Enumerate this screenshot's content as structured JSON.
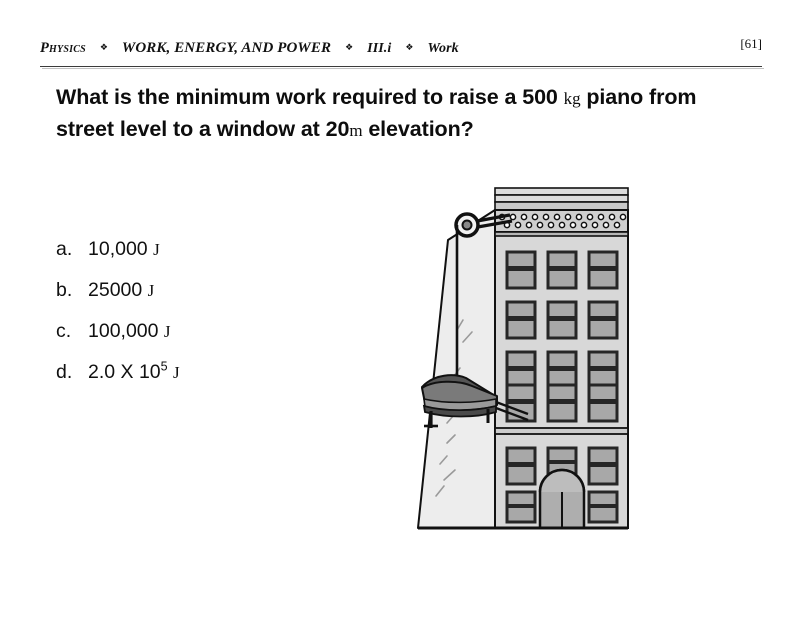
{
  "header": {
    "course": "Physics",
    "separator": "❖",
    "unit": "WORK, ENERGY, AND POWER",
    "section": "III.i",
    "topic": "Work",
    "page_label": "[61]"
  },
  "question": {
    "part1": "What is the minimum work required to raise a 500 ",
    "unit_mass": "kg",
    "part2": " piano from street level to a window at 20",
    "unit_length": "m",
    "part3": " elevation?"
  },
  "answers": [
    {
      "letter": "a.",
      "value": "10,000",
      "unit": "J",
      "exponent": ""
    },
    {
      "letter": "b.",
      "value": "25000",
      "unit": "J",
      "exponent": ""
    },
    {
      "letter": "c.",
      "value": "100,000",
      "unit": "J",
      "exponent": ""
    },
    {
      "letter": "d.",
      "value": "2.0 X 10",
      "unit": "J",
      "exponent": "5"
    }
  ],
  "illustration": {
    "name": "building-with-piano-hoist",
    "elements": [
      "pulley-icon",
      "hoist-cable",
      "grand-piano",
      "apartment-building",
      "cornice-medallions",
      "arched-doorway",
      "windows"
    ],
    "floors_upper": 5,
    "floors_lower": 1,
    "windows_per_floor": 3,
    "colors": {
      "facade": "#d8d8d8",
      "facade_side": "#e8e8e8",
      "window_pane": "#a8a8a8",
      "window_frame": "#262626",
      "cornice": "#cfcfcf",
      "cornice_band": "#b8b8b8",
      "piano_body": "#4a4a4a",
      "piano_lid": "#6e6e6e",
      "outline": "#111111"
    }
  }
}
